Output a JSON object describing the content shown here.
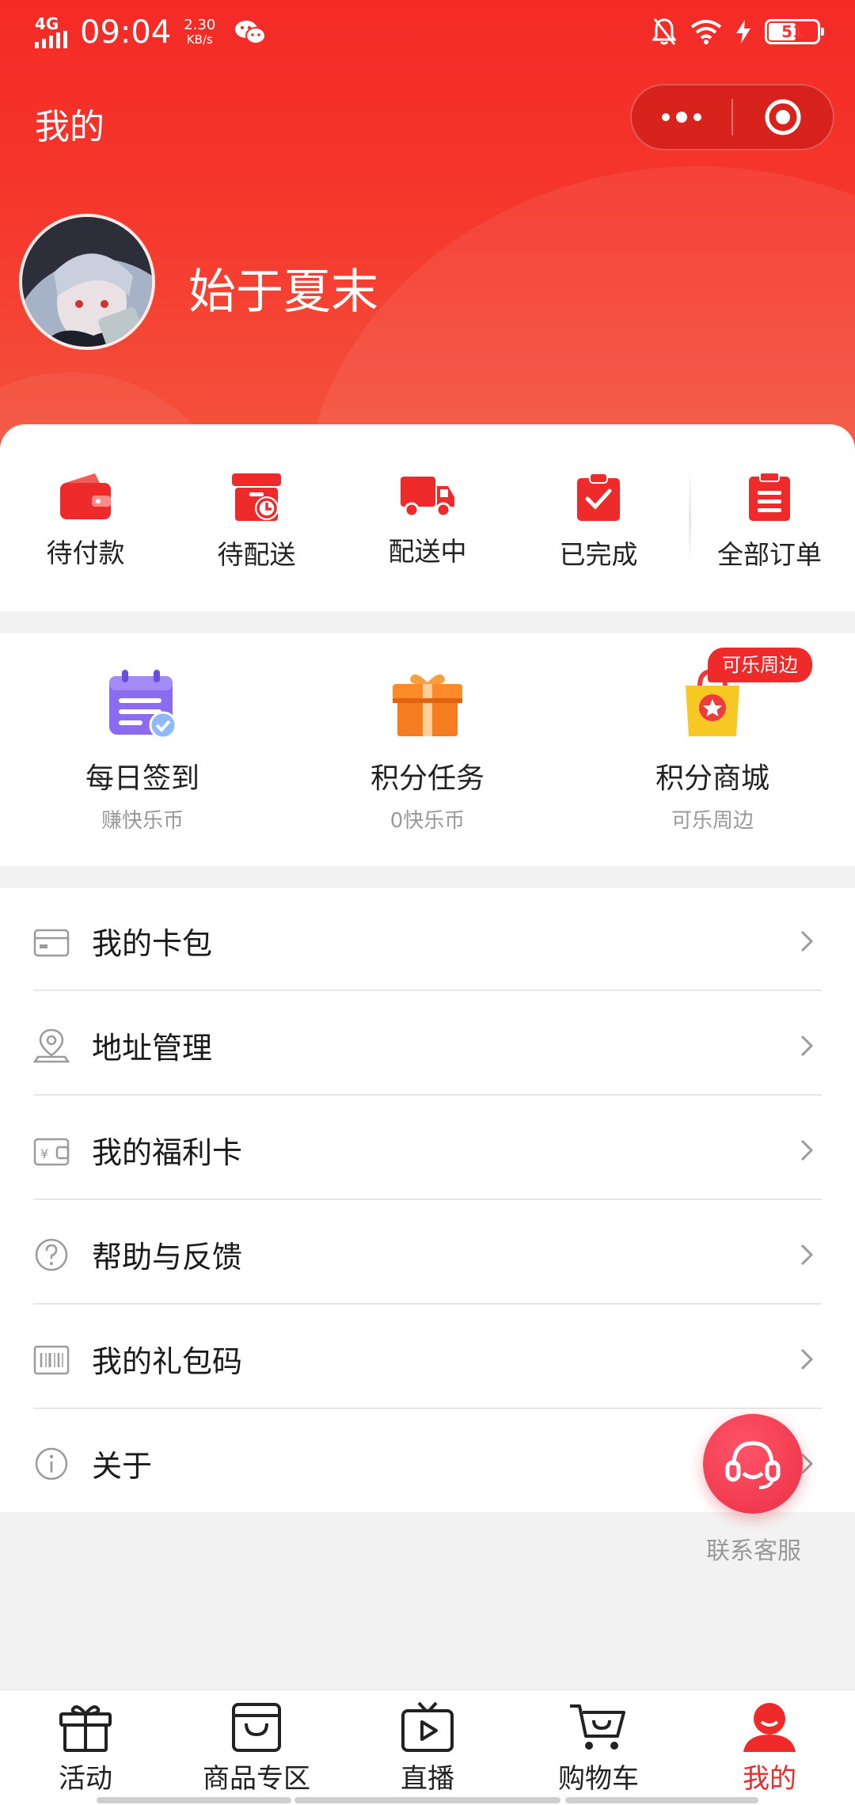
{
  "status_bar": {
    "network": "4G",
    "time": "09:04",
    "speed_value": "2.30",
    "speed_unit": "KB/s",
    "battery": "51"
  },
  "header": {
    "title": "我的",
    "username": "始于夏末"
  },
  "orders": [
    {
      "label": "待付款",
      "icon": "wallet-icon"
    },
    {
      "label": "待配送",
      "icon": "package-clock-icon"
    },
    {
      "label": "配送中",
      "icon": "truck-icon"
    },
    {
      "label": "已完成",
      "icon": "clipboard-check-icon"
    },
    {
      "label": "全部订单",
      "icon": "order-list-icon"
    }
  ],
  "points": [
    {
      "title": "每日签到",
      "subtitle": "赚快乐币",
      "icon": "calendar-check-icon"
    },
    {
      "title": "积分任务",
      "subtitle": "0快乐币",
      "icon": "gift-box-icon"
    },
    {
      "title": "积分商城",
      "subtitle": "可乐周边",
      "icon": "shopping-bag-star-icon"
    }
  ],
  "points_badge": "可乐周边",
  "menu": [
    {
      "label": "我的卡包",
      "icon": "card-wallet-icon"
    },
    {
      "label": "地址管理",
      "icon": "location-pin-icon"
    },
    {
      "label": "我的福利卡",
      "icon": "yen-card-icon"
    },
    {
      "label": "帮助与反馈",
      "icon": "help-circle-icon"
    },
    {
      "label": "我的礼包码",
      "icon": "barcode-icon"
    },
    {
      "label": "关于",
      "icon": "info-circle-icon"
    }
  ],
  "floating_service": {
    "label": "联系客服"
  },
  "tabbar": [
    {
      "label": "活动",
      "icon": "gift-icon",
      "active": false
    },
    {
      "label": "商品专区",
      "icon": "shopping-bag-icon",
      "active": false
    },
    {
      "label": "直播",
      "icon": "tv-play-icon",
      "active": false
    },
    {
      "label": "购物车",
      "icon": "cart-icon",
      "active": false
    },
    {
      "label": "我的",
      "icon": "user-icon",
      "active": true
    }
  ],
  "colors": {
    "brand_red": "#ee2a2a",
    "header_red": "#f42a26",
    "points_purple": "#8b6cf0",
    "points_orange": "#f57c1f",
    "points_yellow": "#f7c724",
    "service_pink": "#eb2f45"
  }
}
